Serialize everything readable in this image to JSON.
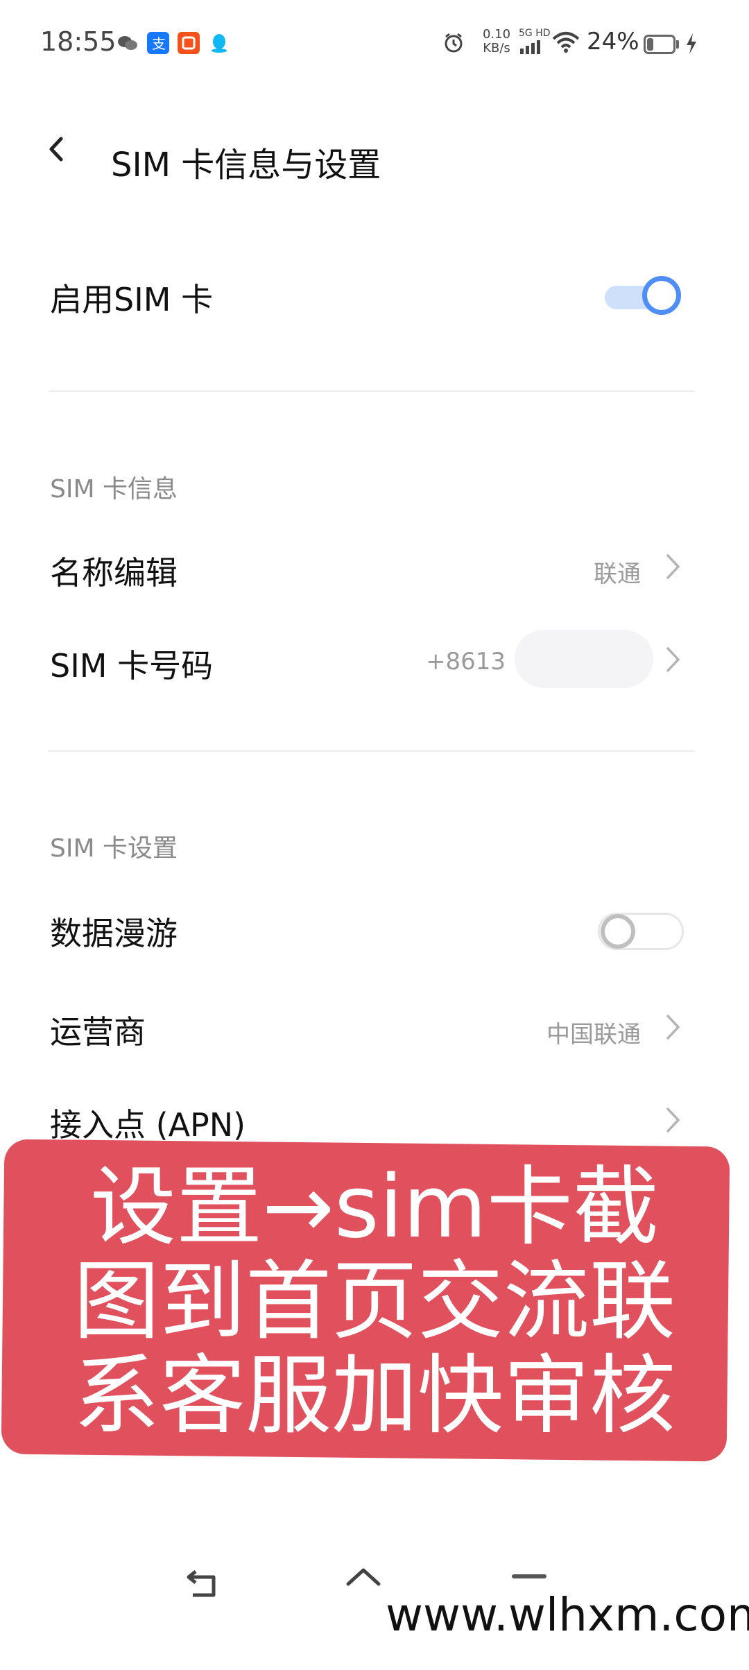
{
  "status_bar": {
    "time": "18:55",
    "net_speed_value": "0.10",
    "net_speed_unit": "KB/s",
    "signal_label": "5G HD",
    "battery_percent": "24%",
    "battery_level": 0.24,
    "app_icons": [
      "wechat-icon",
      "alipay-icon",
      "taobao-icon",
      "qq-icon"
    ],
    "right_icons": [
      "alarm-icon",
      "signal-icon",
      "wifi-icon",
      "battery-icon",
      "charging-icon"
    ]
  },
  "header": {
    "title": "SIM 卡信息与设置"
  },
  "enable_sim": {
    "label": "启用SIM 卡",
    "enabled": true
  },
  "sim_info": {
    "section_title": "SIM 卡信息",
    "name_edit": {
      "label": "名称编辑",
      "value": "联通"
    },
    "number": {
      "label": "SIM 卡号码",
      "value": "+8613"
    }
  },
  "sim_settings": {
    "section_title": "SIM 卡设置",
    "data_roaming": {
      "label": "数据漫游",
      "enabled": false
    },
    "carrier": {
      "label": "运营商",
      "value": "中国联通"
    },
    "apn": {
      "label": "接入点 (APN)"
    }
  },
  "overlay": {
    "lines": [
      "设置→sim卡截",
      "图到首页交流联",
      "系客服加快审核"
    ],
    "color": "#e0515d"
  },
  "watermark": "www.wlhxm.com",
  "colors": {
    "accent": "#4f8ef7",
    "secondary_text": "#9a9a9a"
  }
}
